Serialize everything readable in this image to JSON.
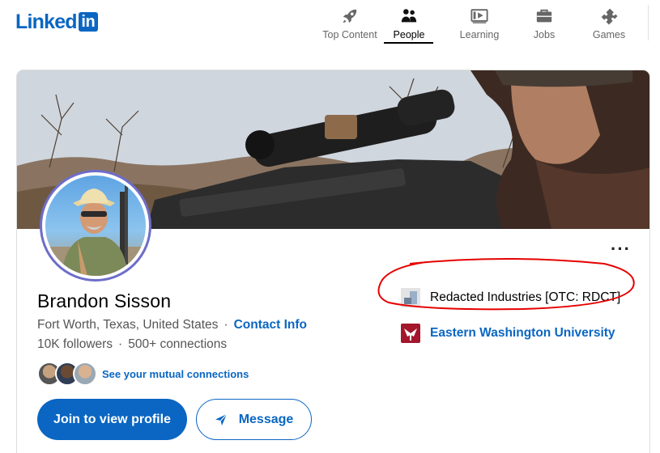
{
  "brand": {
    "wordmark": "Linked",
    "box": "in",
    "color": "#0a66c2"
  },
  "nav": {
    "items": [
      {
        "label": "Top Content",
        "icon": "rocket-icon"
      },
      {
        "label": "People",
        "icon": "people-icon",
        "active": true
      },
      {
        "label": "Learning",
        "icon": "play-box-icon"
      },
      {
        "label": "Jobs",
        "icon": "briefcase-icon"
      },
      {
        "label": "Games",
        "icon": "puzzle-icon"
      }
    ]
  },
  "profile": {
    "name": "Brandon Sisson",
    "location": "Fort Worth, Texas, United States",
    "separator": "·",
    "contact_info": "Contact Info",
    "followers": "10K followers",
    "connections": "500+ connections",
    "mutual_link": "See your mutual connections",
    "more_label": "···",
    "join_button": "Join to view profile",
    "message_button": "Message",
    "company": "Redacted Industries [OTC: RDCT]",
    "education": "Eastern Washington University"
  },
  "colors": {
    "accent": "#0a66c2",
    "annotation": "#e60000",
    "avatar_ring": "#6d6dc9",
    "edu_logo": "#a3162c"
  }
}
